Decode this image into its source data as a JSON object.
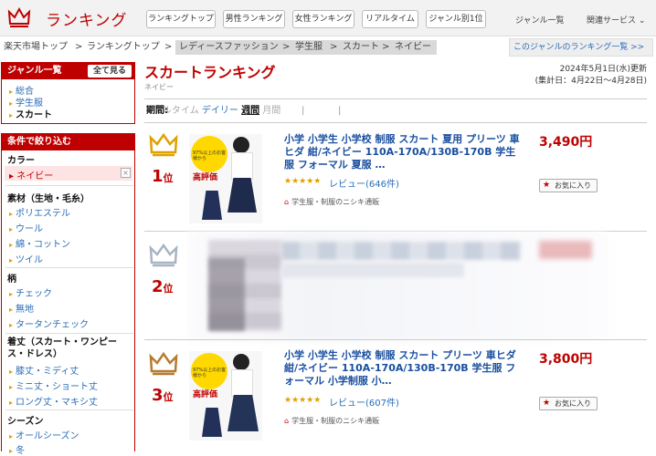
{
  "header": {
    "brand": "ランキング",
    "nav": [
      "ランキングトップ",
      "男性ランキング",
      "女性ランキング",
      "リアルタイム",
      "ジャンル別1位"
    ],
    "genre_list": "ジャンル一覧",
    "related": "関連サービス ⌄"
  },
  "breadcrumb": [
    "楽天市場トップ",
    ">",
    "ランキングトップ",
    ">",
    "レディースファッション",
    ">",
    "学生服",
    ">",
    "スカート",
    ">",
    "ネイビー"
  ],
  "genre_link": "このジャンルのランキング一覧 >>",
  "sidebar": {
    "genre_heading": "ジャンル一覧",
    "show_all": "全て見る",
    "genres": [
      "総合",
      "学生服",
      "スカート"
    ],
    "filter_heading": "条件で絞り込む",
    "color_label": "カラー",
    "color_selected": "ネイビー",
    "material_label": "素材（生地・毛糸）",
    "materials": [
      "ポリエステル",
      "ウール",
      "綿・コットン",
      "ツイル"
    ],
    "pattern_label": "柄",
    "patterns": [
      "チェック",
      "無地",
      "タータンチェック"
    ],
    "length_label": "着丈（スカート・ワンピース・ドレス）",
    "lengths": [
      "膝丈・ミディ丈",
      "ミニ丈・ショート丈",
      "ロング丈・マキシ丈"
    ],
    "season_label": "シーズン",
    "seasons": [
      "オールシーズン",
      "冬"
    ]
  },
  "page": {
    "title": "スカートランキング",
    "subtitle": "ネイビー",
    "date": "2024年5月1日(水)更新",
    "period_range": "(集計日：4月22日〜4月28日)"
  },
  "period": {
    "label": "期間:",
    "options": [
      "リアルタイム",
      "デイリー",
      "週間",
      "月間"
    ],
    "selected": "週間"
  },
  "items": [
    {
      "rank": "1",
      "unit": "位",
      "title": "小学 小学生 小学校 制服 スカート 夏用 プリーツ 車ヒダ 紺/ネイビー 110A-170A/130B-170B 学生服 フォーマル 夏服 …",
      "rating": "★★★★★",
      "review": "レビュー(646件)",
      "shop": "学生服・制服のニシキ通販",
      "price": "3,490円",
      "fav": "お気に入り",
      "img_badge": "97%以上のお客様から",
      "img_label": "高評価"
    },
    {
      "rank": "2",
      "unit": "位"
    },
    {
      "rank": "3",
      "unit": "位",
      "title": "小学 小学生 小学校 制服 スカート プリーツ 車ヒダ 紺/ネイビー 110A-170A/130B-170B 学生服 フォーマル 小学制服 小…",
      "rating": "★★★★★",
      "review": "レビュー(607件)",
      "shop": "学生服・制服のニシキ通販",
      "price": "3,800円",
      "fav": "お気に入り",
      "img_badge": "97%以上のお客様から",
      "img_label": "高評価"
    }
  ],
  "colors": {
    "accent": "#bf0000",
    "link": "#2a6db6",
    "gold": "#e0a000",
    "silver": "#a9b4c2",
    "bronze": "#b77a2e"
  }
}
